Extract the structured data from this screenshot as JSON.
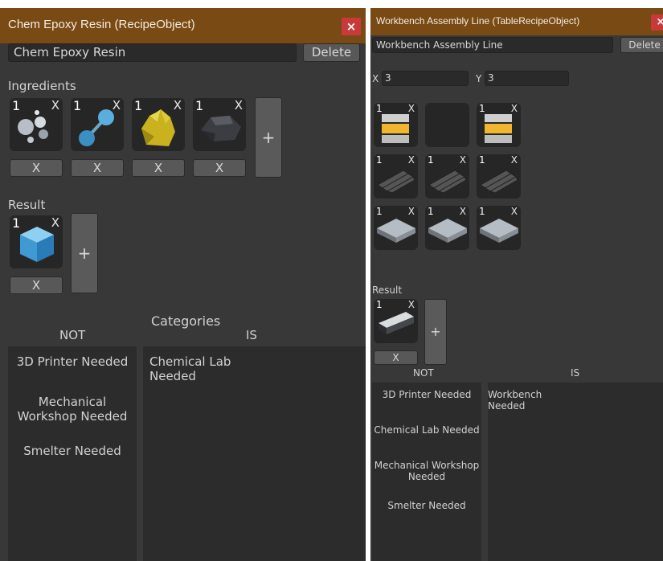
{
  "left_panel": {
    "title": "Chem Epoxy Resin (RecipeObject)",
    "close": "×",
    "name_value": "Chem Epoxy Resin",
    "delete_label": "Delete",
    "ingredients_label": "Ingredients",
    "ingredients": [
      {
        "qty": "1",
        "icon": "spheres-icon"
      },
      {
        "qty": "1",
        "icon": "molecule-icon"
      },
      {
        "qty": "1",
        "icon": "yellow-crystal-icon"
      },
      {
        "qty": "1",
        "icon": "dark-rock-icon"
      }
    ],
    "remove_label": "X",
    "slot_x": "X",
    "add_label": "+",
    "result_label": "Result",
    "result": {
      "qty": "1",
      "icon": "blue-cube-icon"
    },
    "categories_label": "Categories",
    "not_label": "NOT",
    "is_label": "IS",
    "not_items": [
      "3D Printer Needed",
      "Mechanical Workshop Needed",
      "Smelter Needed"
    ],
    "is_items": [
      "Chemical Lab Needed"
    ]
  },
  "right_panel": {
    "title": "Workbench Assembly Line (TableRecipeObject)",
    "close": "×",
    "name_value": "Workbench Assembly Line",
    "delete_label": "Delete",
    "x_label": "X",
    "x_value": "3",
    "y_label": "Y",
    "y_value": "3",
    "grid": [
      {
        "qty": "1",
        "icon": "panel-icon"
      },
      {
        "qty": "",
        "icon": ""
      },
      {
        "qty": "1",
        "icon": "panel-icon"
      },
      {
        "qty": "1",
        "icon": "pipes-icon"
      },
      {
        "qty": "1",
        "icon": "pipes-icon"
      },
      {
        "qty": "1",
        "icon": "pipes-icon"
      },
      {
        "qty": "1",
        "icon": "floor-tile-icon"
      },
      {
        "qty": "1",
        "icon": "floor-tile-icon"
      },
      {
        "qty": "1",
        "icon": "floor-tile-icon"
      }
    ],
    "slot_x": "X",
    "result_label": "Result",
    "result": {
      "qty": "1",
      "icon": "workbench-icon"
    },
    "remove_label": "X",
    "add_label": "+",
    "not_label": "NOT",
    "is_label": "IS",
    "not_items": [
      "3D Printer Needed",
      "Chemical Lab Needed",
      "Mechanical Workshop Needed",
      "Smelter Needed"
    ],
    "is_items": [
      "Workbench Needed"
    ]
  }
}
